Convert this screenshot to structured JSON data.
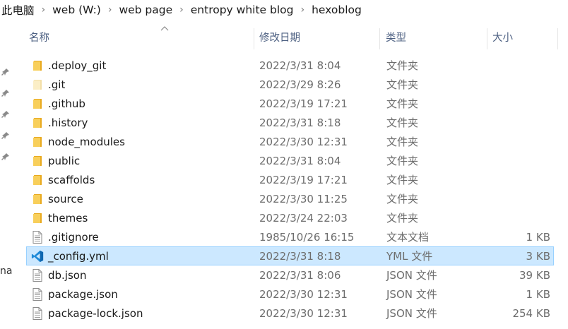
{
  "breadcrumb": [
    "此电脑",
    "web (W:)",
    "web page",
    "entropy white blog",
    "hexoblog"
  ],
  "left_pane_text": "na",
  "columns": {
    "name": "名称",
    "date": "修改日期",
    "type": "类型",
    "size": "大小"
  },
  "files": [
    {
      "name": ".deploy_git",
      "date": "2022/3/31 8:04",
      "type": "文件夹",
      "size": "",
      "icon": "folder-icon"
    },
    {
      "name": ".git",
      "date": "2022/3/29 8:26",
      "type": "文件夹",
      "size": "",
      "icon": "folder-hidden-icon"
    },
    {
      "name": ".github",
      "date": "2022/3/19 17:21",
      "type": "文件夹",
      "size": "",
      "icon": "folder-icon"
    },
    {
      "name": ".history",
      "date": "2022/3/31 8:18",
      "type": "文件夹",
      "size": "",
      "icon": "folder-icon"
    },
    {
      "name": "node_modules",
      "date": "2022/3/30 12:31",
      "type": "文件夹",
      "size": "",
      "icon": "folder-icon"
    },
    {
      "name": "public",
      "date": "2022/3/31 8:04",
      "type": "文件夹",
      "size": "",
      "icon": "folder-icon"
    },
    {
      "name": "scaffolds",
      "date": "2022/3/19 17:21",
      "type": "文件夹",
      "size": "",
      "icon": "folder-icon"
    },
    {
      "name": "source",
      "date": "2022/3/30 11:25",
      "type": "文件夹",
      "size": "",
      "icon": "folder-icon"
    },
    {
      "name": "themes",
      "date": "2022/3/24 22:03",
      "type": "文件夹",
      "size": "",
      "icon": "folder-icon"
    },
    {
      "name": ".gitignore",
      "date": "1985/10/26 16:15",
      "type": "文本文档",
      "size": "1 KB",
      "icon": "text-file-icon"
    },
    {
      "name": "_config.yml",
      "date": "2022/3/31 8:18",
      "type": "YML 文件",
      "size": "3 KB",
      "icon": "vscode-file-icon",
      "selected": true
    },
    {
      "name": "db.json",
      "date": "2022/3/31 8:06",
      "type": "JSON 文件",
      "size": "39 KB",
      "icon": "text-file-icon"
    },
    {
      "name": "package.json",
      "date": "2022/3/30 12:31",
      "type": "JSON 文件",
      "size": "1 KB",
      "icon": "text-file-icon"
    },
    {
      "name": "package-lock.json",
      "date": "2022/3/30 12:31",
      "type": "JSON 文件",
      "size": "254 KB",
      "icon": "text-file-icon"
    }
  ],
  "colors": {
    "selection_bg": "#cce8ff",
    "selection_border": "#99d1ff",
    "folder": "#f5c542",
    "header_text": "#4d6082"
  }
}
